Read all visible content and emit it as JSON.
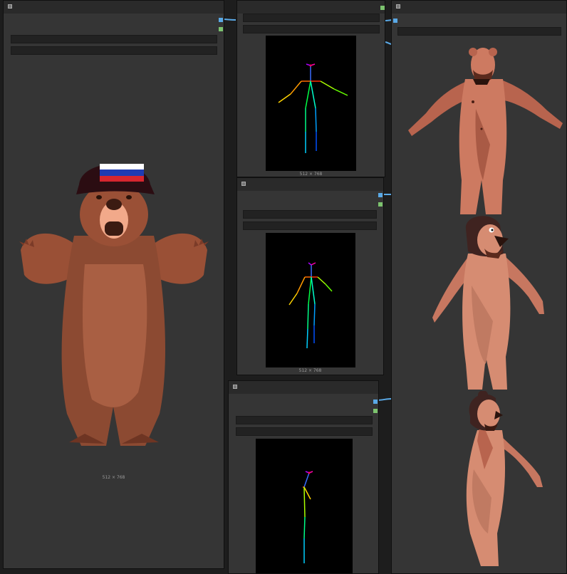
{
  "app": {
    "accent_color": "#5aa9e6",
    "mask_port_color": "#7cc36e",
    "node_bg_color": "#353535",
    "canvas_bg_color": "#1d1d1d"
  },
  "nodes": {
    "load_image": {
      "preview_label": "512 × 768",
      "icon": "russian-bear-cartoon"
    },
    "pose_preview_1": {
      "preview_label": "512 × 768",
      "icon": "openpose-skeleton-front"
    },
    "pose_preview_2": {
      "preview_label": "512 × 768",
      "icon": "openpose-skeleton-three-quarter"
    },
    "pose_preview_3": {
      "preview_label": "",
      "icon": "openpose-skeleton-side"
    },
    "output_gallery": {
      "images": [
        {
          "icon": "bear-man-front-pose"
        },
        {
          "icon": "bear-man-three-quarter-pose"
        },
        {
          "icon": "bear-man-side-pose"
        }
      ]
    }
  }
}
